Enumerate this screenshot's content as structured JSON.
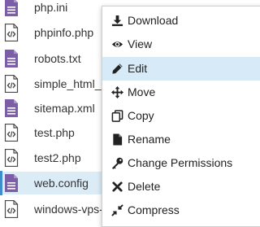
{
  "files": [
    {
      "name": "php.ini",
      "type": "text-document"
    },
    {
      "name": "phpinfo.php",
      "type": "code"
    },
    {
      "name": "robots.txt",
      "type": "text-document"
    },
    {
      "name": "simple_html_",
      "type": "code"
    },
    {
      "name": "sitemap.xml",
      "type": "text-document"
    },
    {
      "name": "test.php",
      "type": "code"
    },
    {
      "name": "test2.php",
      "type": "code"
    },
    {
      "name": "web.config",
      "type": "text-document",
      "selected": true
    },
    {
      "name": "windows-vps-",
      "type": "code"
    }
  ],
  "context_menu": {
    "items": [
      {
        "label": "Download",
        "icon": "download-icon"
      },
      {
        "label": "View",
        "icon": "eye-icon"
      },
      {
        "label": "Edit",
        "icon": "pencil-icon",
        "highlighted": true
      },
      {
        "label": "Move",
        "icon": "move-arrows-icon"
      },
      {
        "label": "Copy",
        "icon": "copy-icon"
      },
      {
        "label": "Rename",
        "icon": "file-icon"
      },
      {
        "label": "Change Permissions",
        "icon": "key-icon"
      },
      {
        "label": "Delete",
        "icon": "close-x-icon"
      },
      {
        "label": "Compress",
        "icon": "compress-icon"
      }
    ]
  },
  "colors": {
    "document_icon": "#7b5ea7",
    "code_icon": "#4a4a4a",
    "selection_bar": "#3e8ecf",
    "menu_highlight": "#d6eaf8"
  }
}
